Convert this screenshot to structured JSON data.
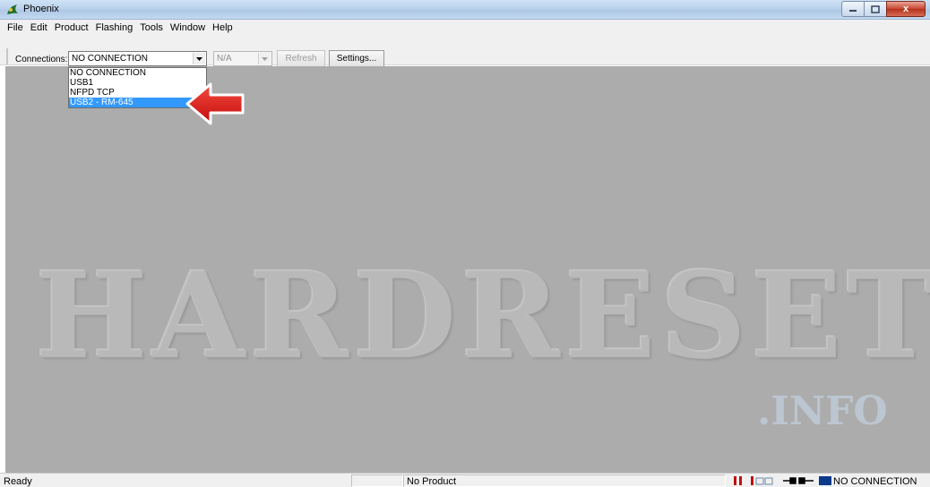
{
  "window": {
    "title": "Phoenix",
    "icon": "phoenix-app-icon",
    "controls": [
      "minimize-icon",
      "maximize-icon",
      "close-icon"
    ],
    "close_glyph": "x"
  },
  "menu": [
    "File",
    "Edit",
    "Product",
    "Flashing",
    "Tools",
    "Window",
    "Help"
  ],
  "toolbar": {
    "connections_label": "Connections:",
    "connection_selected": "NO CONNECTION",
    "secondary_selected": "N/A",
    "refresh_label": "Refresh",
    "settings_label": "Settings..."
  },
  "dropdown": {
    "options": [
      "NO CONNECTION",
      "USB1",
      "NFPD TCP",
      "USB2 - RM-645"
    ],
    "highlighted_index": 3
  },
  "watermark": {
    "main": "HARDRESET",
    "sub": ".INFO"
  },
  "status": {
    "text": "Ready",
    "product": "No Product",
    "connection": "NO CONNECTION"
  },
  "colors": {
    "highlight": "#3399ff",
    "arrow": "#e01818",
    "workarea": "#acacac"
  }
}
